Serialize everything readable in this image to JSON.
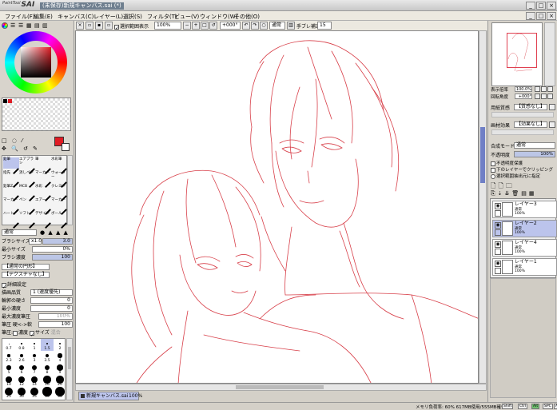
{
  "app": {
    "logo": "SAI",
    "logo_prefix": "PaintTool",
    "window_title": "(未保存)新規キャンバス.sai (*)"
  },
  "menu": [
    "ファイル(F)",
    "編集(E)",
    "キャンバス(C)",
    "レイヤー(L)",
    "選択(S)",
    "フィルタ(T)",
    "ビュー(V)",
    "ウィンドウ(W)",
    "その他(O)"
  ],
  "toolbar": {
    "show_selection_label": "選択範囲表示",
    "zoom": "100%",
    "angle": "+000°",
    "blend": "通常",
    "stabilizer_label": "手ブレ補正",
    "stabilizer": "15"
  },
  "left": {
    "tools": [
      [
        "鉛筆",
        "エアブラシ",
        "筆",
        "水彩筆"
      ],
      [
        "指先",
        "消しペン",
        "マーカー",
        "ウォーター"
      ],
      [
        "鉛筆Z",
        "MCB",
        "水彩",
        "クレヨン"
      ],
      [
        "マーカー",
        "ペン",
        "エアー",
        "マーカー"
      ],
      [
        "ハート",
        "ソフト",
        "デザイン",
        "ボール"
      ]
    ],
    "blend_mode": "通常",
    "brush_size_label": "ブラシサイズ",
    "brush_size_mult": "x1.0",
    "brush_size": "3.0",
    "min_size_label": "最小サイズ",
    "min_size": "0%",
    "density_label": "ブラシ濃度",
    "density": "100",
    "shape1": "【通常の円形】",
    "shape2": "【テクスチャなし】",
    "detail_label": "詳細設定",
    "quality_label": "描画品質",
    "quality": "1 (速度優先)",
    "edge_label": "輪郭の硬さ",
    "edge": "0",
    "min_density_label": "最小濃度",
    "min_density": "0",
    "max_pressure_label": "最大濃度筆圧",
    "max_pressure": "100%",
    "pressure_hard_label": "筆圧 硬<->軟",
    "pressure_hard": "100",
    "pressure_label": "筆圧:",
    "pressure_density": "濃度",
    "pressure_size": "サイズ",
    "pressure_blend": "混合",
    "sizes": [
      "0.7",
      "0.8",
      "1",
      "1.5",
      "2",
      "2.3",
      "2.6",
      "3",
      "3.5",
      "4",
      "5",
      "6",
      "7",
      "8",
      "9",
      "10",
      "12",
      "14",
      "16",
      "20",
      "25",
      "30",
      "35",
      "40",
      "50"
    ]
  },
  "right": {
    "zoom_label": "表示倍率",
    "zoom": "100.0%",
    "angle_label": "回転角度",
    "angle": "+000°",
    "paper_label": "用紙質感",
    "paper": "【質感なし】",
    "effect_label": "画材効果",
    "effect": "【効果なし】",
    "blend_label": "合成モード",
    "blend": "通常",
    "opacity_label": "不透明度",
    "opacity": "100%",
    "protect_opacity": "不透明度保護",
    "clip": "下のレイヤーでクリッピング",
    "select_source": "選択範囲抽出元に指定",
    "layers": [
      {
        "name": "レイヤー3",
        "mode": "通常",
        "opacity": "100%",
        "selected": false
      },
      {
        "name": "レイヤー2",
        "mode": "通常",
        "opacity": "100%",
        "selected": true
      },
      {
        "name": "レイヤー4",
        "mode": "通常",
        "opacity": "100%",
        "selected": false
      },
      {
        "name": "レイヤー1",
        "mode": "通常",
        "opacity": "100%",
        "selected": false
      }
    ]
  },
  "doc_tab": {
    "name": "新規キャンバス.sai",
    "zoom": "100%"
  },
  "status": {
    "memory": "メモリ負荷率: 60% 617MB使用/555MB確保",
    "keys": [
      "Shift",
      "Ctrl",
      "Alt",
      "SPC",
      "Any"
    ]
  },
  "colors": {
    "accent": "#6f7f8f",
    "stroke": "#d8404a",
    "selected_layer": "#bcc4ec",
    "fg_color": "#e01c24"
  }
}
